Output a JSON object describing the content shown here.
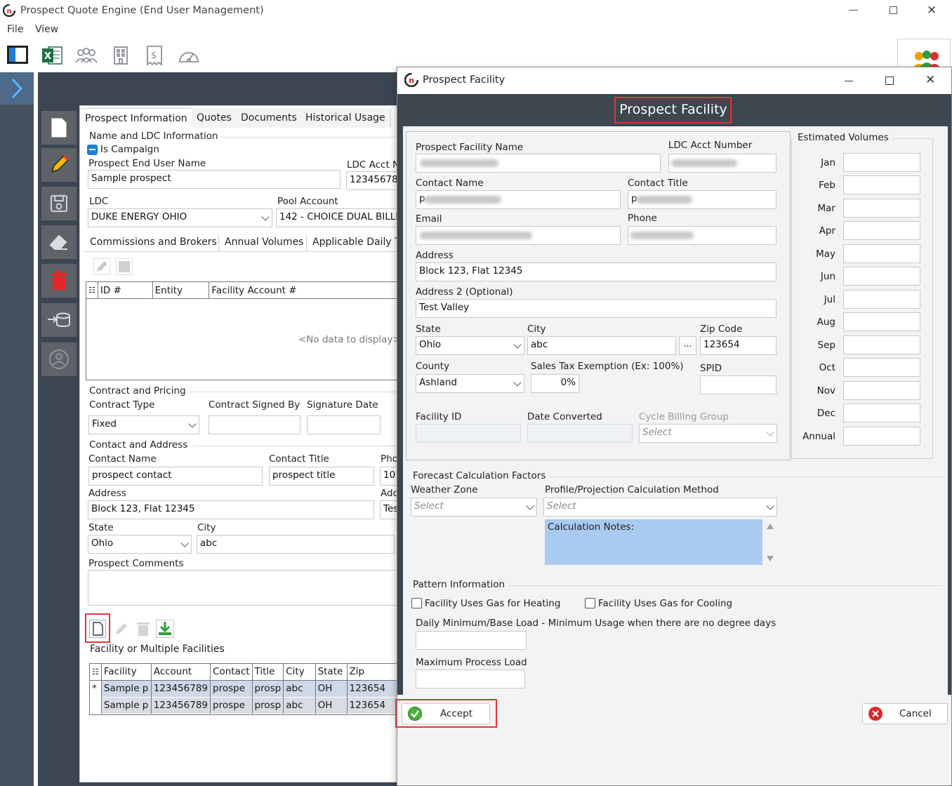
{
  "app": {
    "title": "Prospect Quote Engine (End User Management)",
    "menu": [
      "File",
      "View"
    ]
  },
  "main": {
    "tabs": [
      "Prospect Information",
      "Quotes",
      "Documents",
      "Historical Usage"
    ],
    "name_ldc_group": "Name and LDC Information",
    "is_campaign": "Is Campaign",
    "end_user_name_label": "Prospect End User Name",
    "end_user_name": "Sample prospect",
    "ldc_acct_label": "LDC Acct N",
    "ldc_acct_value": "12345678",
    "ldc_label": "LDC",
    "ldc_value": "DUKE ENERGY OHIO",
    "pool_label": "Pool Account",
    "pool_value": "142 - CHOICE DUAL BILLE",
    "subtabs": [
      "Commissions and Brokers",
      "Annual Volumes",
      "Applicable Daily Ty"
    ],
    "brokers_columns": [
      "ID #",
      "Entity",
      "Facility Account #"
    ],
    "no_data": "<No data to display>",
    "contract_group": "Contract and Pricing",
    "contract_type_label": "Contract Type",
    "contract_type_value": "Fixed",
    "signed_by_label": "Contract Signed By",
    "signature_date_label": "Signature Date",
    "contact_group": "Contact and Address",
    "contact_name_label": "Contact Name",
    "contact_name_value": "prospect contact",
    "contact_title_label": "Contact Title",
    "contact_title_value": "prospect title",
    "phone_label_cut": "Pho",
    "phone_value_cut": "10",
    "address_label": "Address",
    "address_value": "Block 123, Flat 12345",
    "address2_label_cut": "Add",
    "address2_value_cut": "Tes",
    "state_label": "State",
    "state_value": "Ohio",
    "city_label": "City",
    "city_value": "abc",
    "comments_label": "Prospect Comments",
    "facilities_group": "Facility or Multiple Facilities",
    "facility_columns": [
      "Facility",
      "Account",
      "Contact",
      "Title",
      "City",
      "State",
      "Zip"
    ],
    "facility_rows": [
      {
        "marker": "*",
        "cells": [
          "Sample p",
          "123456789",
          "prospe",
          "prosp",
          "abc",
          "OH",
          "123654"
        ]
      },
      {
        "marker": "",
        "cells": [
          "Sample p",
          "123456789",
          "prospe",
          "prosp",
          "abc",
          "OH",
          "123654"
        ]
      }
    ]
  },
  "dialog": {
    "window_title": "Prospect Facility",
    "header_title": "Prospect Facility",
    "facility_name_label": "Prospect Facility Name",
    "ldc_acct_label": "LDC Acct Number",
    "contact_name_label": "Contact Name",
    "contact_name_value": "p",
    "contact_title_label": "Contact Title",
    "contact_title_value": "p",
    "email_label": "Email",
    "phone_label": "Phone",
    "address_label": "Address",
    "address_value": "Block 123, Flat 12345",
    "address2_label": "Address 2 (Optional)",
    "address2_value": "Test Valley",
    "state_label": "State",
    "state_value": "Ohio",
    "city_label": "City",
    "city_value": "abc",
    "city_button": "...",
    "zip_label": "Zip Code",
    "zip_value": "123654",
    "county_label": "County",
    "county_value": "Ashland",
    "sales_tax_label": "Sales Tax Exemption (Ex: 100%)",
    "sales_tax_value": "0%",
    "spid_label": "SPID",
    "facility_id_label": "Facility ID",
    "date_converted_label": "Date Converted",
    "cycle_billing_label": "Cycle Billing Group",
    "cycle_billing_placeholder": "Select",
    "volumes_group": "Estimated  Volumes",
    "months": [
      "Jan",
      "Feb",
      "Mar",
      "Apr",
      "May",
      "Jun",
      "Jul",
      "Aug",
      "Sep",
      "Oct",
      "Nov",
      "Dec",
      "Annual"
    ],
    "forecast_group": "Forecast Calculation Factors",
    "weather_zone_label": "Weather Zone",
    "weather_zone_placeholder": "Select",
    "profile_label": "Profile/Projection Calculation Method",
    "profile_placeholder": "Select",
    "calc_notes": "Calculation Notes:",
    "pattern_group": "Pattern Information",
    "heating_label": "Facility Uses Gas for Heating",
    "cooling_label": "Facility Uses Gas for Cooling",
    "daily_min_label": "Daily Minimum/Base Load - Minimum Usage when there are no degree days",
    "max_process_label": "Maximum Process Load",
    "accept_label": "Accept",
    "cancel_label": "Cancel"
  },
  "colors": {
    "rail": "#44505e",
    "canvas": "#3c4652",
    "rail_button": "#5f6368",
    "dialog_header": "#3e4650",
    "highlight_box": "#e0353d",
    "notes_bg": "#a9cbf0",
    "selected_row": "#cdd9e8"
  }
}
